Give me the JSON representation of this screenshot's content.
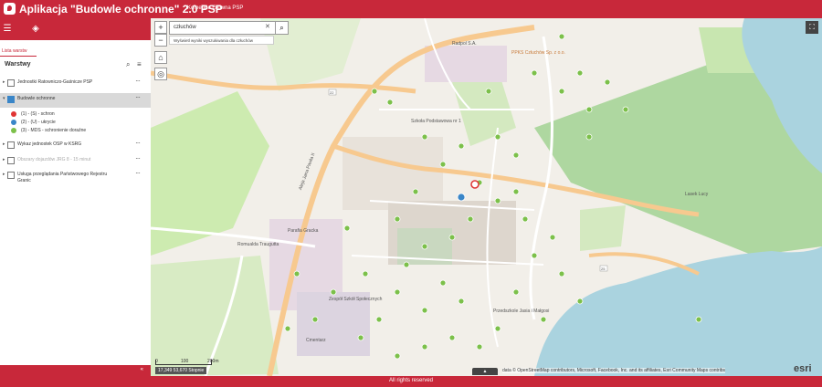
{
  "header": {
    "title": "Aplikacja \"Budowle ochronne\" 2.0 PSP",
    "subtitle": "Komenda Główna PSP"
  },
  "sidebar": {
    "tab_label": "Lista warstw",
    "layers_heading": "Warstwy",
    "layers": [
      {
        "label": "Jednostki Ratowniczo-Gaśnicze PSP",
        "checked": false,
        "visible": true
      },
      {
        "label": "Budowle ochronne",
        "checked": true,
        "visible": true
      },
      {
        "label": "Wykaz jednostek OSP w KSRG",
        "checked": false,
        "visible": true
      },
      {
        "label": "Obszary dojazdów JRG 8 - 15 minut",
        "checked": false,
        "visible": false
      },
      {
        "label": "Usługa przeglądania Państwowego Rejestru",
        "label2": "Granic",
        "checked": false,
        "visible": true
      }
    ],
    "legend": [
      {
        "label": "(1) - (S) - schron",
        "color": "#e03535"
      },
      {
        "label": "(2) - (U) - ukrycie",
        "color": "#3a86c8"
      },
      {
        "label": "(3) - MDS - schronienie doraźne",
        "color": "#7cc04a"
      }
    ]
  },
  "map": {
    "search_value": "człuchów",
    "search_hint": "Wyświetl wyniki wyszukiwania dla człuchów",
    "attribution": "data © OpenStreetMap contributors, Microsoft, Facebook, Inc. and its affiliates, Esri Community Maps contribs",
    "esri_logo": "esri",
    "coords": "17,349 53,670 Stopnie",
    "scale_labels": [
      "0",
      "100",
      "200m"
    ],
    "place_labels": {
      "lake": "Lasek Lucy",
      "radpol": "Radpol S.A.",
      "pppks": "PPKS Człuchów Sp. z o.o.",
      "school": "Szkoła Podstawowa nr 1",
      "parish": "Parafia Gracka",
      "church": "Kościół",
      "cemetery": "Cmentarz",
      "szkola2": "Zespół Szkół Społecznych",
      "przedszkole": "Przedszkole Jasia i Małgosi",
      "road1": "Aleja Jana Pawła II",
      "road2": "Romualda Traugutta",
      "road3": "Mickiewicza",
      "road_num_22": "22",
      "road_num_25": "25"
    }
  },
  "footer": {
    "text": "All rights reserved"
  }
}
